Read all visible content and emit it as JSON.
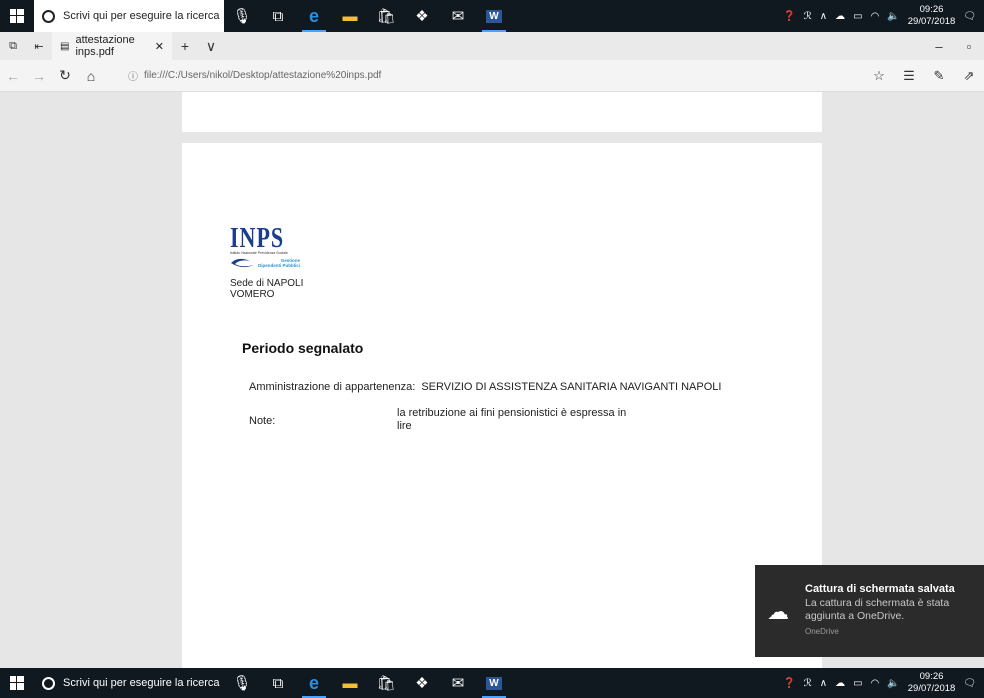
{
  "taskbar": {
    "search_placeholder": "Scrivi qui per eseguire la ricerca",
    "time": "09:26",
    "date": "29/07/2018"
  },
  "browser": {
    "tab_title": "attestazione inps.pdf",
    "url": "file:///C:/Users/nikol/Desktop/attestazione%20inps.pdf"
  },
  "document": {
    "logo_text": "INPS",
    "logo_subtitle": "Istituto Nazionale Previdenza Sociale",
    "logo_gestione": "Gestione",
    "logo_dipendenti": "Dipendenti Pubblici",
    "sede_line1": "Sede di NAPOLI",
    "sede_line2": "VOMERO",
    "heading": "Periodo segnalato",
    "amm_label": "Amministrazione di appartenenza:",
    "amm_value": "SERVIZIO DI ASSISTENZA SANITARIA NAVIGANTI NAPOLI",
    "note_label": "Note:",
    "note_line1": "la retribuzione ai fini pensionistici è espressa in",
    "note_line2": "lire"
  },
  "toast": {
    "title": "Cattura di schermata salvata",
    "body_line1": "La cattura di schermata è stata",
    "body_line2": "aggiunta a OneDrive.",
    "source": "OneDrive"
  },
  "icons": [
    "windows-icon",
    "cortana-icon",
    "mic-icon",
    "task-view-icon",
    "edge-icon",
    "explorer-icon",
    "store-icon",
    "dropbox-icon",
    "mail-icon",
    "word-icon",
    "help-icon",
    "people-icon",
    "chevron-up-icon",
    "onedrive-icon",
    "battery-icon",
    "wifi-icon",
    "volume-icon",
    "notification-icon"
  ]
}
